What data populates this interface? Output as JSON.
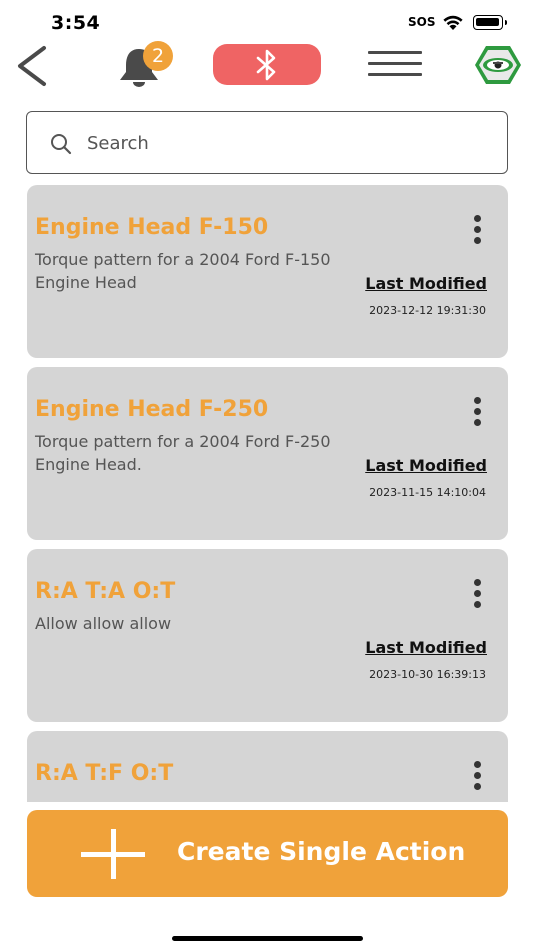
{
  "status": {
    "time": "3:54",
    "sos": "SOS",
    "battery_level": 0.9
  },
  "nav": {
    "notification_count": "2",
    "bluetooth_color": "#EF6464",
    "accent_color": "#F0A23A"
  },
  "search": {
    "placeholder": "Search",
    "value": ""
  },
  "items": [
    {
      "title": "Engine Head F-150",
      "description": "Torque pattern for a 2004 Ford F-150 Engine Head",
      "modified_label": "Last Modified",
      "modified_date": "2023-12-12 19:31:30"
    },
    {
      "title": "Engine Head F-250",
      "description": "Torque pattern for a 2004 Ford F-250 Engine Head.",
      "modified_label": "Last Modified",
      "modified_date": "2023-11-15 14:10:04"
    },
    {
      "title": "R:A T:A O:T",
      "description": "Allow allow allow",
      "modified_label": "Last Modified",
      "modified_date": "2023-10-30 16:39:13"
    },
    {
      "title": "R:A T:F O:T",
      "description": "",
      "modified_label": "",
      "modified_date": ""
    }
  ],
  "create_button": {
    "label": "Create Single Action"
  }
}
